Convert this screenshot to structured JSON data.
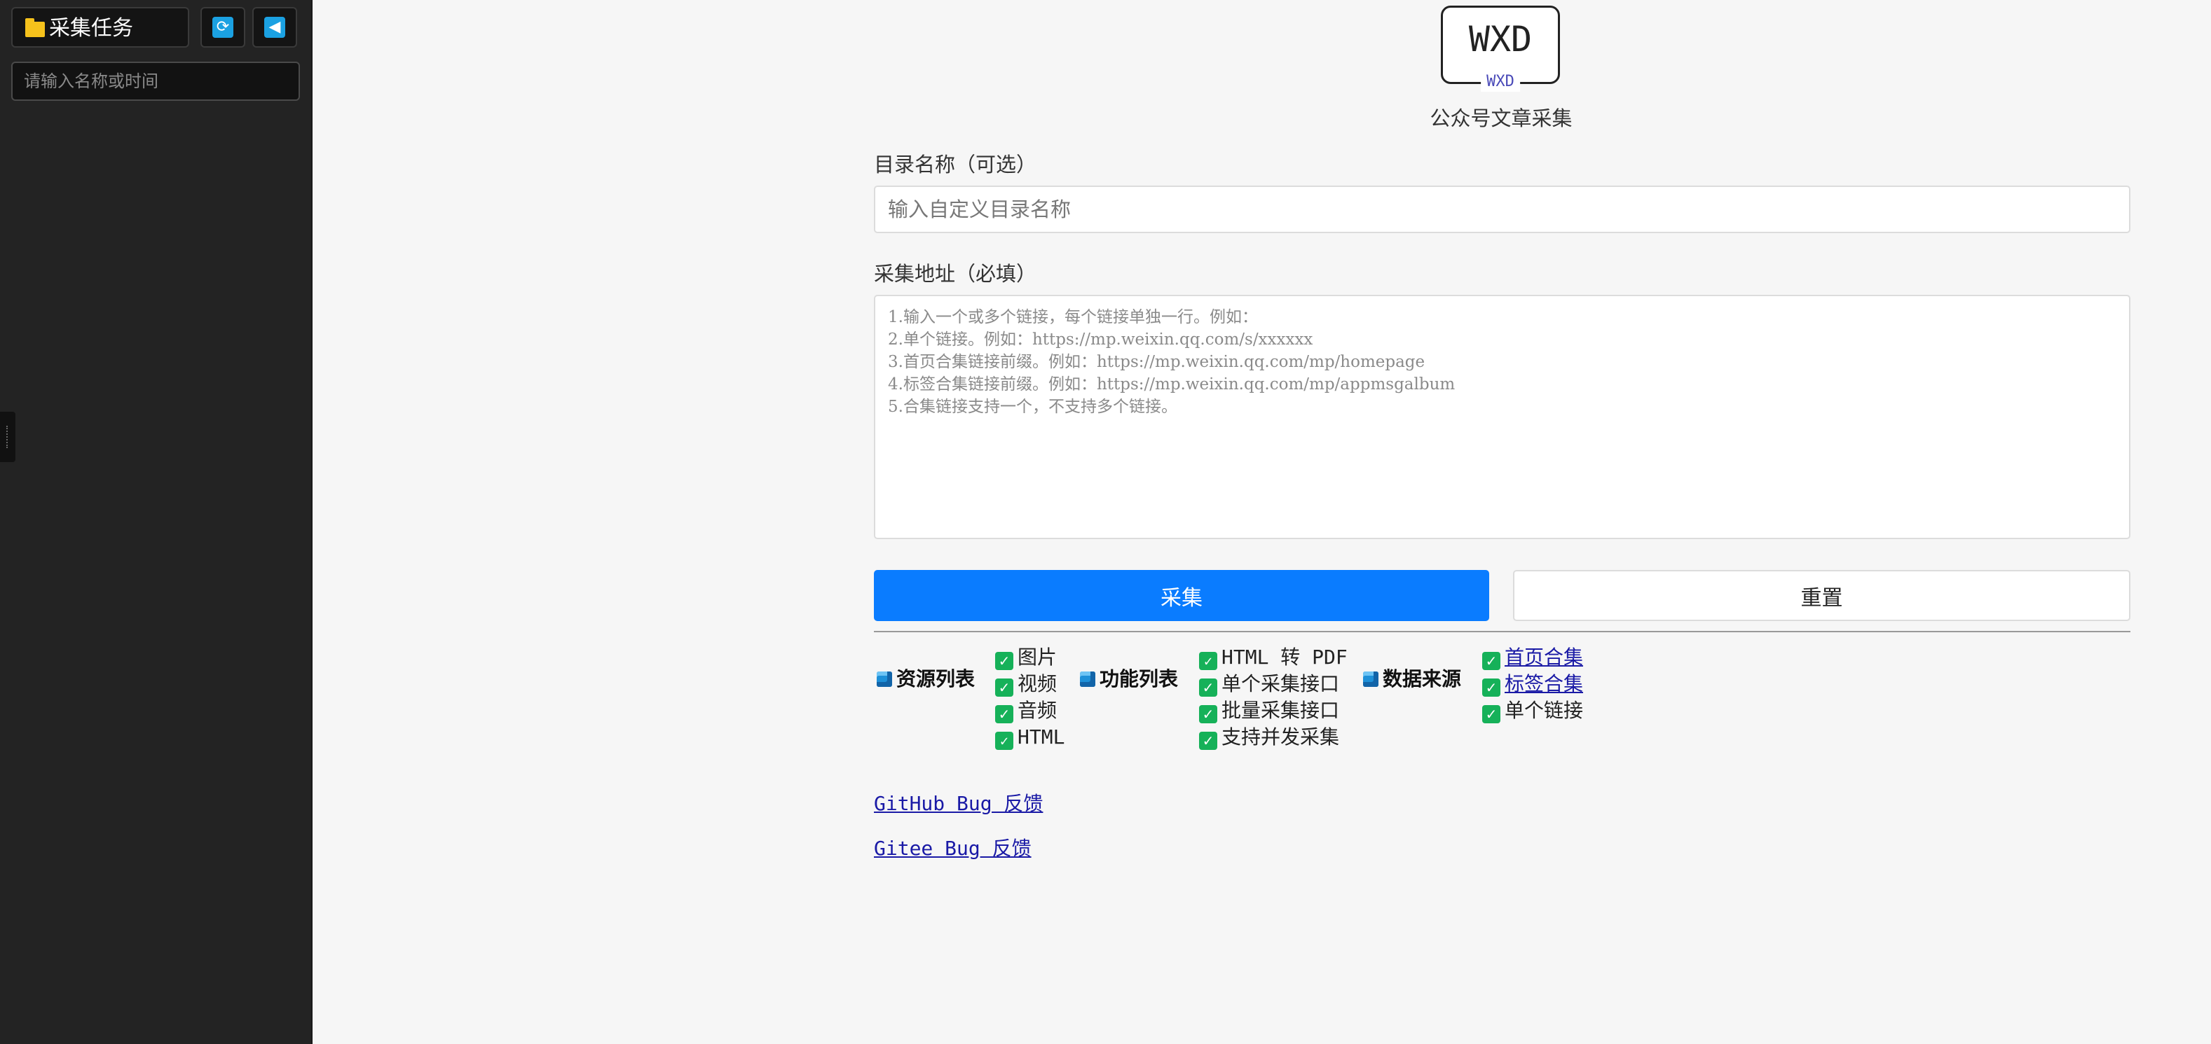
{
  "sidebar": {
    "task_label": "采集任务",
    "search_placeholder": "请输入名称或时间"
  },
  "logo": {
    "main": "WXD",
    "sub": "WXD"
  },
  "app_title": "公众号文章采集",
  "form": {
    "dir_label": "目录名称（可选）",
    "dir_placeholder": "输入自定义目录名称",
    "url_label": "采集地址（必填）",
    "url_placeholder": "1.输入一个或多个链接，每个链接单独一行。例如：\n2.单个链接。例如：https://mp.weixin.qq.com/s/xxxxxx\n3.首页合集链接前缀。例如：https://mp.weixin.qq.com/mp/homepage\n4.标签合集链接前缀。例如：https://mp.weixin.qq.com/mp/appmsgalbum\n5.合集链接支持一个，不支持多个链接。",
    "collect_label": "采集",
    "reset_label": "重置"
  },
  "features": {
    "resources": {
      "title": "资源列表",
      "items": [
        "图片",
        "视频",
        "音频",
        "HTML"
      ]
    },
    "functions": {
      "title": "功能列表",
      "items": [
        "HTML 转 PDF",
        "单个采集接口",
        "批量采集接口",
        "支持并发采集"
      ]
    },
    "sources": {
      "title": "数据来源",
      "items": [
        "首页合集",
        "标签合集",
        "单个链接"
      ]
    }
  },
  "links": {
    "github": "GitHub Bug 反馈",
    "gitee": "Gitee Bug 反馈"
  },
  "colors": {
    "sidebar_bg": "#232323",
    "primary": "#0a7cff",
    "check": "#16b159",
    "link": "#1a1aa6"
  },
  "icons": [
    "folder-icon",
    "refresh-icon",
    "collapse-left-icon",
    "cube-icon",
    "checkbox-checked-icon"
  ]
}
